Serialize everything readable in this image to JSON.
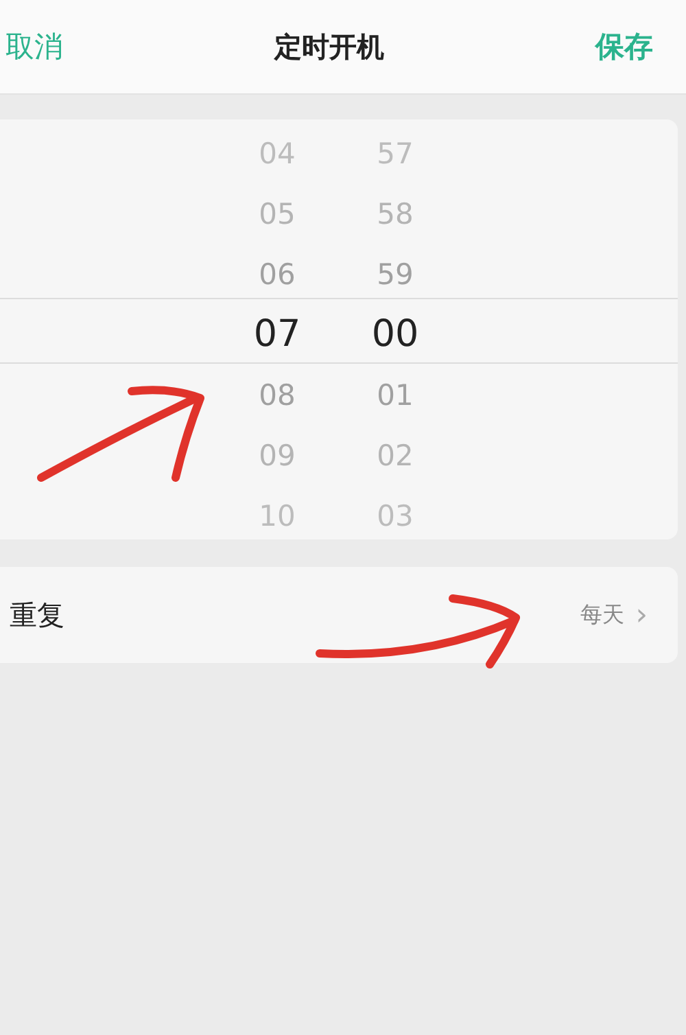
{
  "header": {
    "cancel": "取消",
    "title": "定时开机",
    "save": "保存"
  },
  "picker": {
    "hours": [
      {
        "label": "04",
        "selected": false
      },
      {
        "label": "05",
        "selected": false
      },
      {
        "label": "06",
        "selected": false
      },
      {
        "label": "07",
        "selected": true
      },
      {
        "label": "08",
        "selected": false
      },
      {
        "label": "09",
        "selected": false
      },
      {
        "label": "10",
        "selected": false
      }
    ],
    "minutes": [
      {
        "label": "57",
        "selected": false
      },
      {
        "label": "58",
        "selected": false
      },
      {
        "label": "59",
        "selected": false
      },
      {
        "label": "00",
        "selected": true
      },
      {
        "label": "01",
        "selected": false
      },
      {
        "label": "02",
        "selected": false
      },
      {
        "label": "03",
        "selected": false
      }
    ]
  },
  "repeat": {
    "label": "重复",
    "value": "每天",
    "chevron": "›"
  }
}
